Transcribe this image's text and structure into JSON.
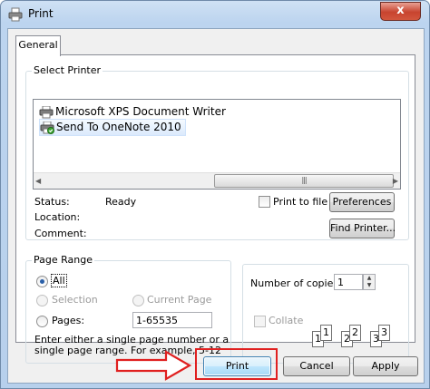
{
  "window": {
    "title": "Print",
    "close_glyph": "x"
  },
  "tabs": [
    {
      "label": "General"
    }
  ],
  "select_printer": {
    "legend": "Select Printer",
    "printers": [
      {
        "name": "Microsoft XPS Document Writer",
        "icon": "printer-icon"
      },
      {
        "name": "Send To OneNote 2010",
        "icon": "printer-default-icon",
        "selected": true
      }
    ],
    "scroll_grip": "|||"
  },
  "status": {
    "status_label": "Status:",
    "status_value": "Ready",
    "location_label": "Location:",
    "comment_label": "Comment:",
    "print_to_file_label": "Print to file",
    "preferences_label": "Preferences",
    "find_printer_label": "Find Printer..."
  },
  "page_range": {
    "legend": "Page Range",
    "all_label": "All",
    "selection_label": "Selection",
    "current_page_label": "Current Page",
    "pages_label": "Pages:",
    "pages_value": "1-65535",
    "hint": "Enter either a single page number or a single page range.  For example, 5-12"
  },
  "copies": {
    "number_label": "Number of copies:",
    "value": "1",
    "collate_label": "Collate",
    "collate_pages": [
      "1",
      "1",
      "2",
      "2",
      "3",
      "3"
    ]
  },
  "footer": {
    "print_label": "Print",
    "cancel_label": "Cancel",
    "apply_label": "Apply"
  },
  "annotation": {
    "arrow_color": "#e02020",
    "highlight_color": "#e02020"
  }
}
